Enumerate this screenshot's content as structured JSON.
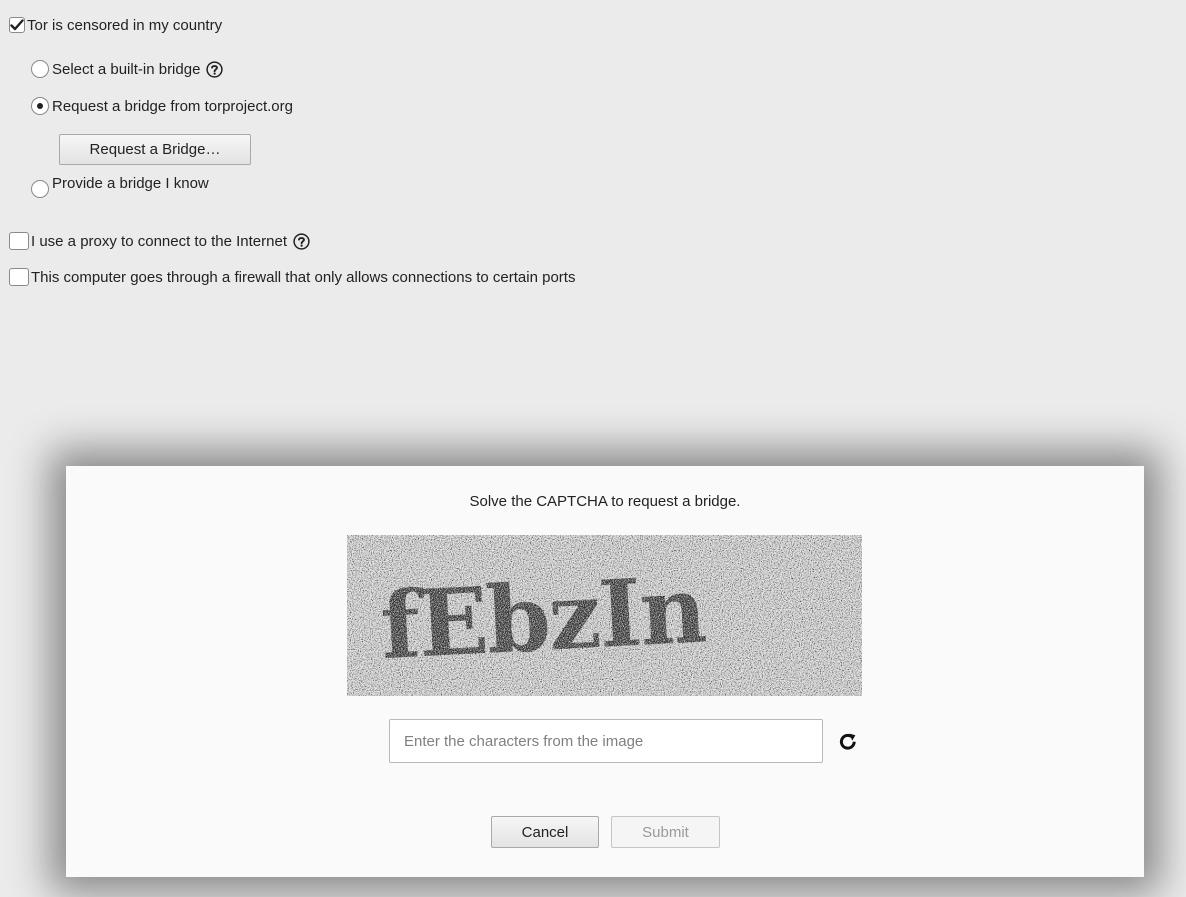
{
  "settings": {
    "censored": {
      "label": "Tor is censored in my country",
      "checked": true
    },
    "bridge_options": [
      {
        "label": "Select a built-in bridge",
        "selected": false,
        "has_help": true
      },
      {
        "label": "Request a bridge from torproject.org",
        "selected": true,
        "has_help": false
      },
      {
        "label": "Provide a bridge I know",
        "selected": false,
        "has_help": false
      }
    ],
    "request_bridge_button": "Request a Bridge…",
    "proxy": {
      "label": "I use a proxy to connect to the Internet",
      "checked": false,
      "has_help": true
    },
    "firewall": {
      "label": "This computer goes through a firewall that only allows connections to certain ports",
      "checked": false
    }
  },
  "captcha_dialog": {
    "prompt": "Solve the CAPTCHA to request a bridge.",
    "captcha_text": "fEbzIn",
    "input_value": "",
    "input_placeholder": "Enter the characters from the image",
    "reload_icon": "reload-icon",
    "cancel_label": "Cancel",
    "submit_label": "Submit",
    "submit_enabled": false
  },
  "colors": {
    "window_bg": "#ebebeb",
    "dialog_bg": "#fafafa",
    "disabled_text": "#9a9a9a"
  }
}
